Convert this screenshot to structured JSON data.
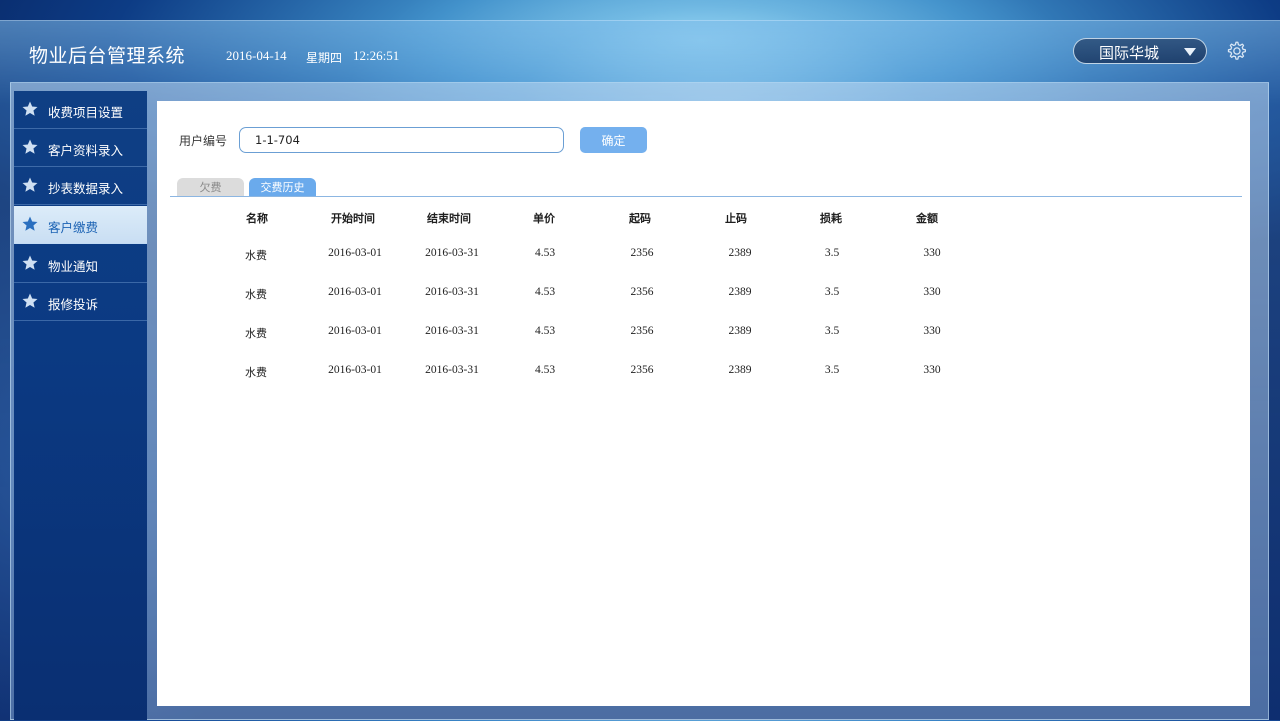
{
  "header": {
    "title": "物业后台管理系统",
    "date": "2016-04-14",
    "weekday": "星期四",
    "time": "12:26:51",
    "org_select": "国际华城",
    "settings_icon": "gear-icon"
  },
  "sidebar": {
    "items": [
      {
        "label": "收费项目设置",
        "icon": "star-icon",
        "active": false
      },
      {
        "label": "客户资料录入",
        "icon": "star-icon",
        "active": false
      },
      {
        "label": "抄表数据录入",
        "icon": "star-icon",
        "active": false
      },
      {
        "label": "客户缴费",
        "icon": "star-icon",
        "active": true
      },
      {
        "label": "物业通知",
        "icon": "star-icon",
        "active": false
      },
      {
        "label": "报修投诉",
        "icon": "star-icon",
        "active": false
      }
    ]
  },
  "search": {
    "label": "用户编号",
    "value": "1-1-704",
    "confirm_label": "确定"
  },
  "tabs": [
    {
      "label": "欠费",
      "active": false
    },
    {
      "label": "交费历史",
      "active": true
    }
  ],
  "table": {
    "columns": [
      "名称",
      "开始时间",
      "结束时间",
      "单价",
      "起码",
      "止码",
      "损耗",
      "金额"
    ],
    "rows": [
      [
        "水费",
        "2016-03-01",
        "2016-03-31",
        "4.53",
        "2356",
        "2389",
        "3.5",
        "330"
      ],
      [
        "水费",
        "2016-03-01",
        "2016-03-31",
        "4.53",
        "2356",
        "2389",
        "3.5",
        "330"
      ],
      [
        "水费",
        "2016-03-01",
        "2016-03-31",
        "4.53",
        "2356",
        "2389",
        "3.5",
        "330"
      ],
      [
        "水费",
        "2016-03-01",
        "2016-03-31",
        "4.53",
        "2356",
        "2389",
        "3.5",
        "330"
      ]
    ]
  },
  "colors": {
    "accent": "#74b0ee",
    "active_tab": "#6aaaec",
    "sidebar_bg": "#0f3f84",
    "sidebar_active_text": "#1c63b4"
  }
}
